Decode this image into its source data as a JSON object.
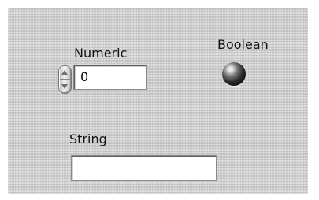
{
  "front_panel": {
    "numeric": {
      "label": "Numeric",
      "value": "0"
    },
    "boolean": {
      "label": "Boolean",
      "state": false
    },
    "string": {
      "label": "String",
      "value": ""
    }
  },
  "icons": {
    "stepper": "increment-decrement-arrows-icon",
    "indicator": "led-indicator-icon"
  },
  "colors": {
    "panel_background": "#d2d2d2",
    "field_background": "#ffffff",
    "indicator_dark": "#2f2f2f"
  }
}
